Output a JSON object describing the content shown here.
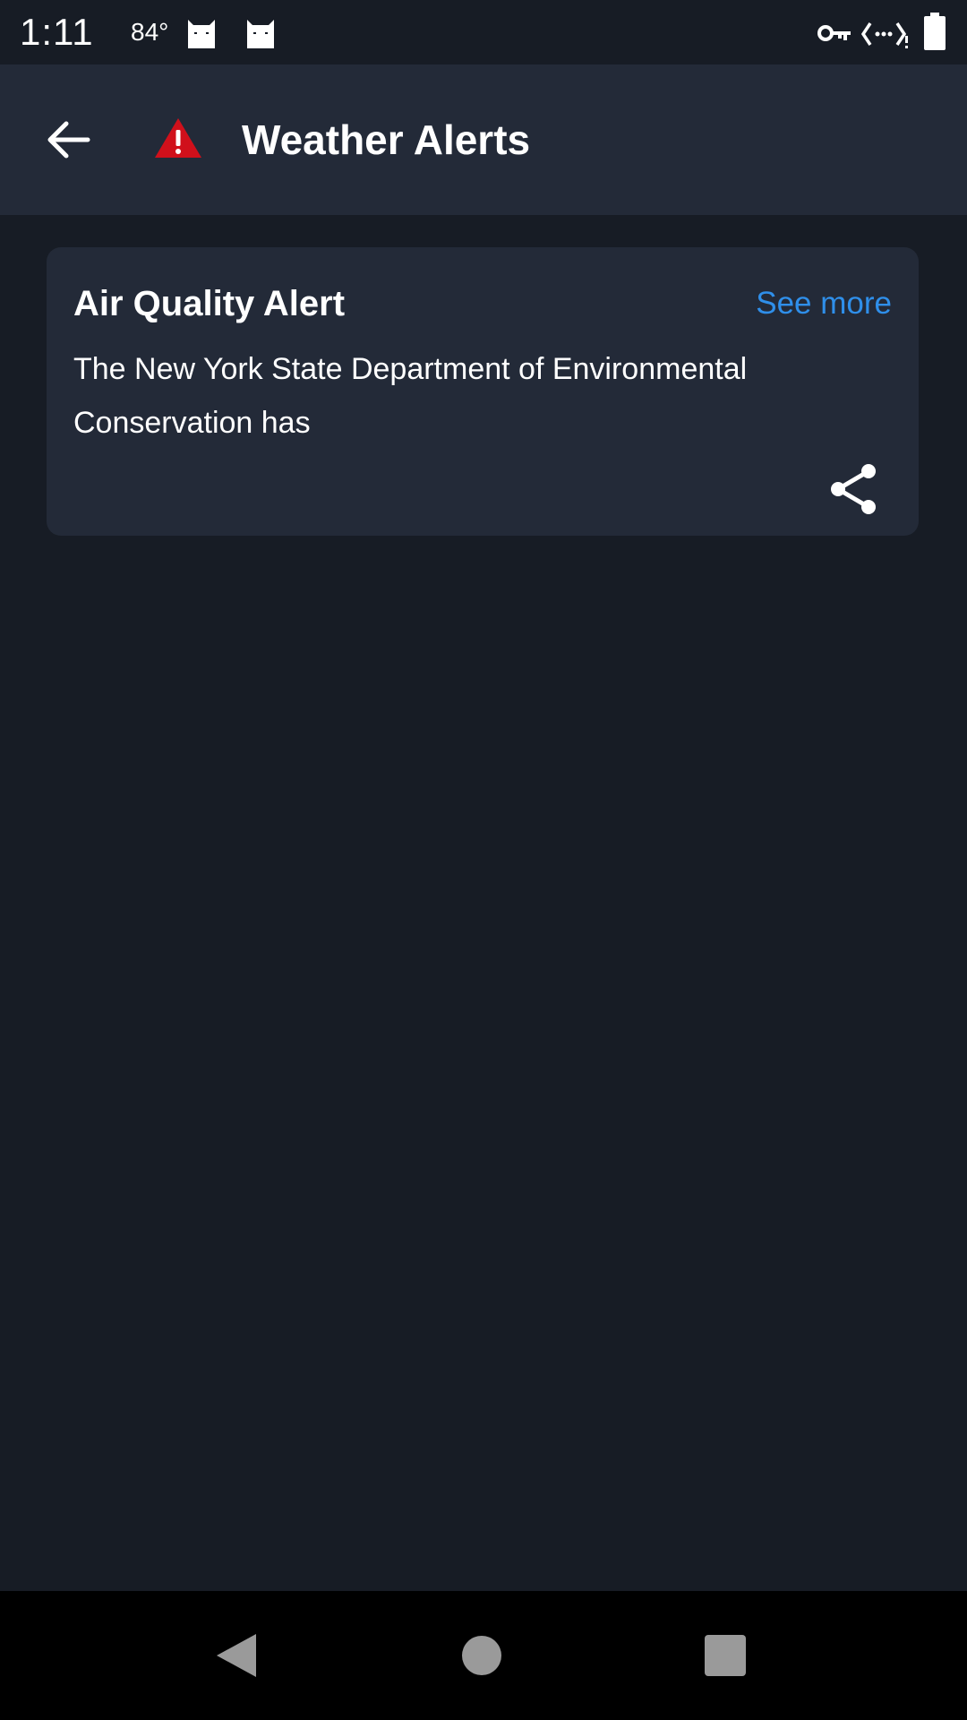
{
  "status_bar": {
    "time": "1:11",
    "temperature": "84°",
    "icons": [
      "cat-icon",
      "cat-icon",
      "vpn-key-icon",
      "data-saver-icon",
      "battery-icon"
    ]
  },
  "app_bar": {
    "title": "Weather Alerts",
    "back_icon": "arrow-left-icon",
    "alert_icon": "warning-triangle-icon",
    "alert_icon_color": "#d0101b"
  },
  "alerts": [
    {
      "title": "Air Quality Alert",
      "see_more_label": "See more",
      "body": "The New York State Department of Environmental Conservation has",
      "share_icon": "share-icon"
    }
  ],
  "colors": {
    "background": "#171c25",
    "surface": "#232a38",
    "accent": "#2f8fea",
    "text": "#ffffff"
  },
  "nav_bar": {
    "icons": [
      "nav-back-icon",
      "nav-home-icon",
      "nav-recents-icon"
    ]
  }
}
